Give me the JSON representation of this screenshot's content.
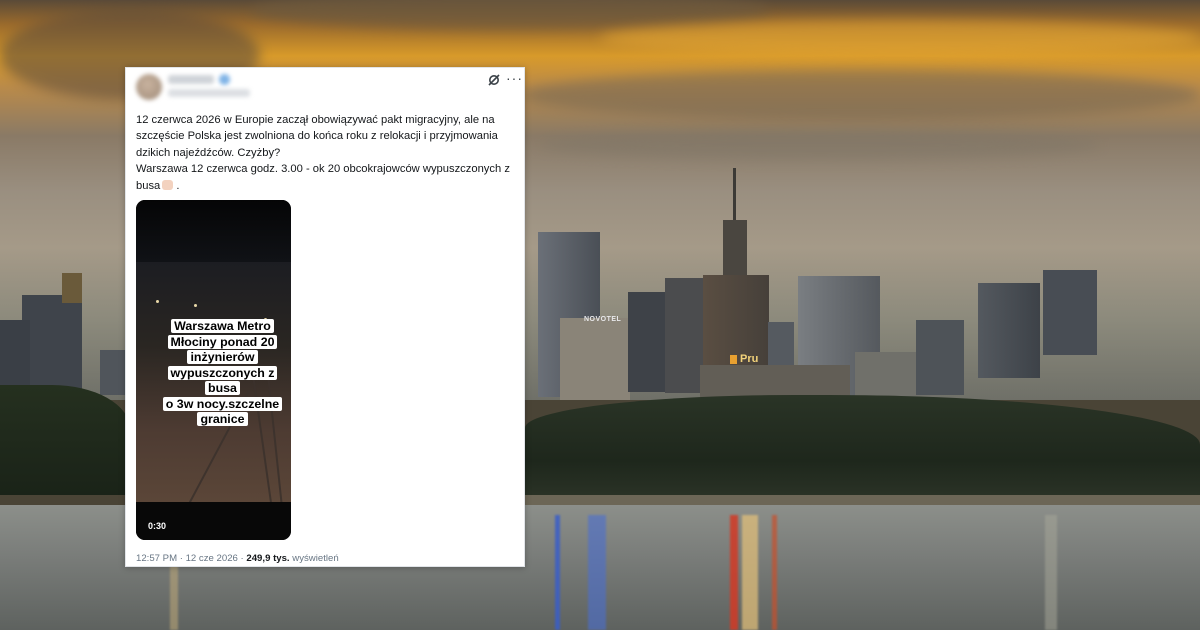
{
  "tweet": {
    "text_lines": [
      "12 czerwca 2026 w Europie zaczął obowiązywać pakt migracyjny, ale na szczęście Polska jest zwolniona do końca roku z relokacji i przyjmowania dzikich najeźdźców. Czyżby?",
      "Warszawa 12 czerwca godz. 3.00 - ok 20 obcokrajowców wypuszczonych z busa",
      "."
    ],
    "timestamp": "12:57 PM · 12 cze 2026 · ",
    "views_count": "249,9 tys.",
    "views_label": "wyświetleń",
    "more_icon": "···"
  },
  "video": {
    "overlay_lines": [
      "Warszawa Metro",
      "Młociny ponad 20",
      "inżynierów",
      "wypuszczonych z busa",
      "o 3w nocy.szczelne",
      "granice"
    ],
    "duration": "0:30"
  },
  "background": {
    "sign_novotel": "NOVOTEL",
    "sign_pru": "Pru",
    "sign_novotel_vertical": "NOVOTEL"
  },
  "colors": {
    "card_bg": "#ffffff",
    "text": "#14171a",
    "muted": "#687684"
  }
}
